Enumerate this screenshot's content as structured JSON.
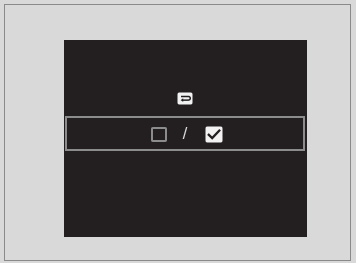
{
  "screen": {
    "background_color": "#231f20",
    "icons": {
      "back": "back-icon",
      "unchecked": "checkbox-unchecked-icon",
      "checked": "checkbox-checked-icon"
    }
  },
  "option_row": {
    "separator": "/",
    "unchecked_state": false,
    "checked_state": true
  }
}
